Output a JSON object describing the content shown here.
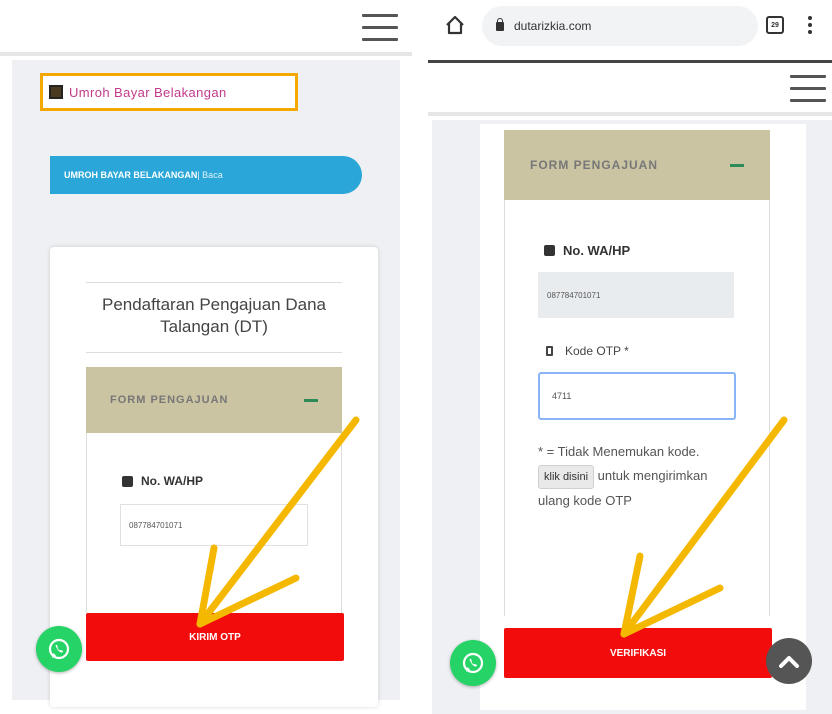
{
  "left": {
    "title": "Umroh Bayar Belakangan",
    "pill": {
      "text": "UMROH BAYAR BELAKANGAN",
      "read": " | Baca"
    },
    "card_title": "Pendaftaran Pengajuan Dana Talangan (DT)",
    "form_header": "FORM PENGAJUAN",
    "wa_label": "No. WA/HP",
    "wa_value": "087784701071",
    "button": "KIRIM OTP"
  },
  "right": {
    "url": "dutarizkia.com",
    "tab_count": "29",
    "form_header": "FORM PENGAJUAN",
    "wa_label": "No. WA/HP",
    "wa_value": "087784701071",
    "otp_label": "Kode OTP *",
    "otp_value": "4711",
    "help_pre": "* = Tidak Menemukan kode.",
    "help_link": "klik disini",
    "help_post": "untuk mengirimkan ulang kode OTP",
    "button": "VERIFIKASI"
  },
  "colors": {
    "accent_red": "#f20c0c",
    "pill_blue": "#2aa7d8",
    "form_header_bg": "#cbc4a3",
    "annotation_arrow": "#f5b800",
    "whatsapp_green": "#25d366"
  },
  "icons": [
    "hamburger-icon",
    "home-icon",
    "lock-icon",
    "tabs-icon",
    "more-vert-icon",
    "phone-icon",
    "mobile-icon",
    "whatsapp-icon",
    "chevron-up-icon",
    "minus-icon"
  ]
}
